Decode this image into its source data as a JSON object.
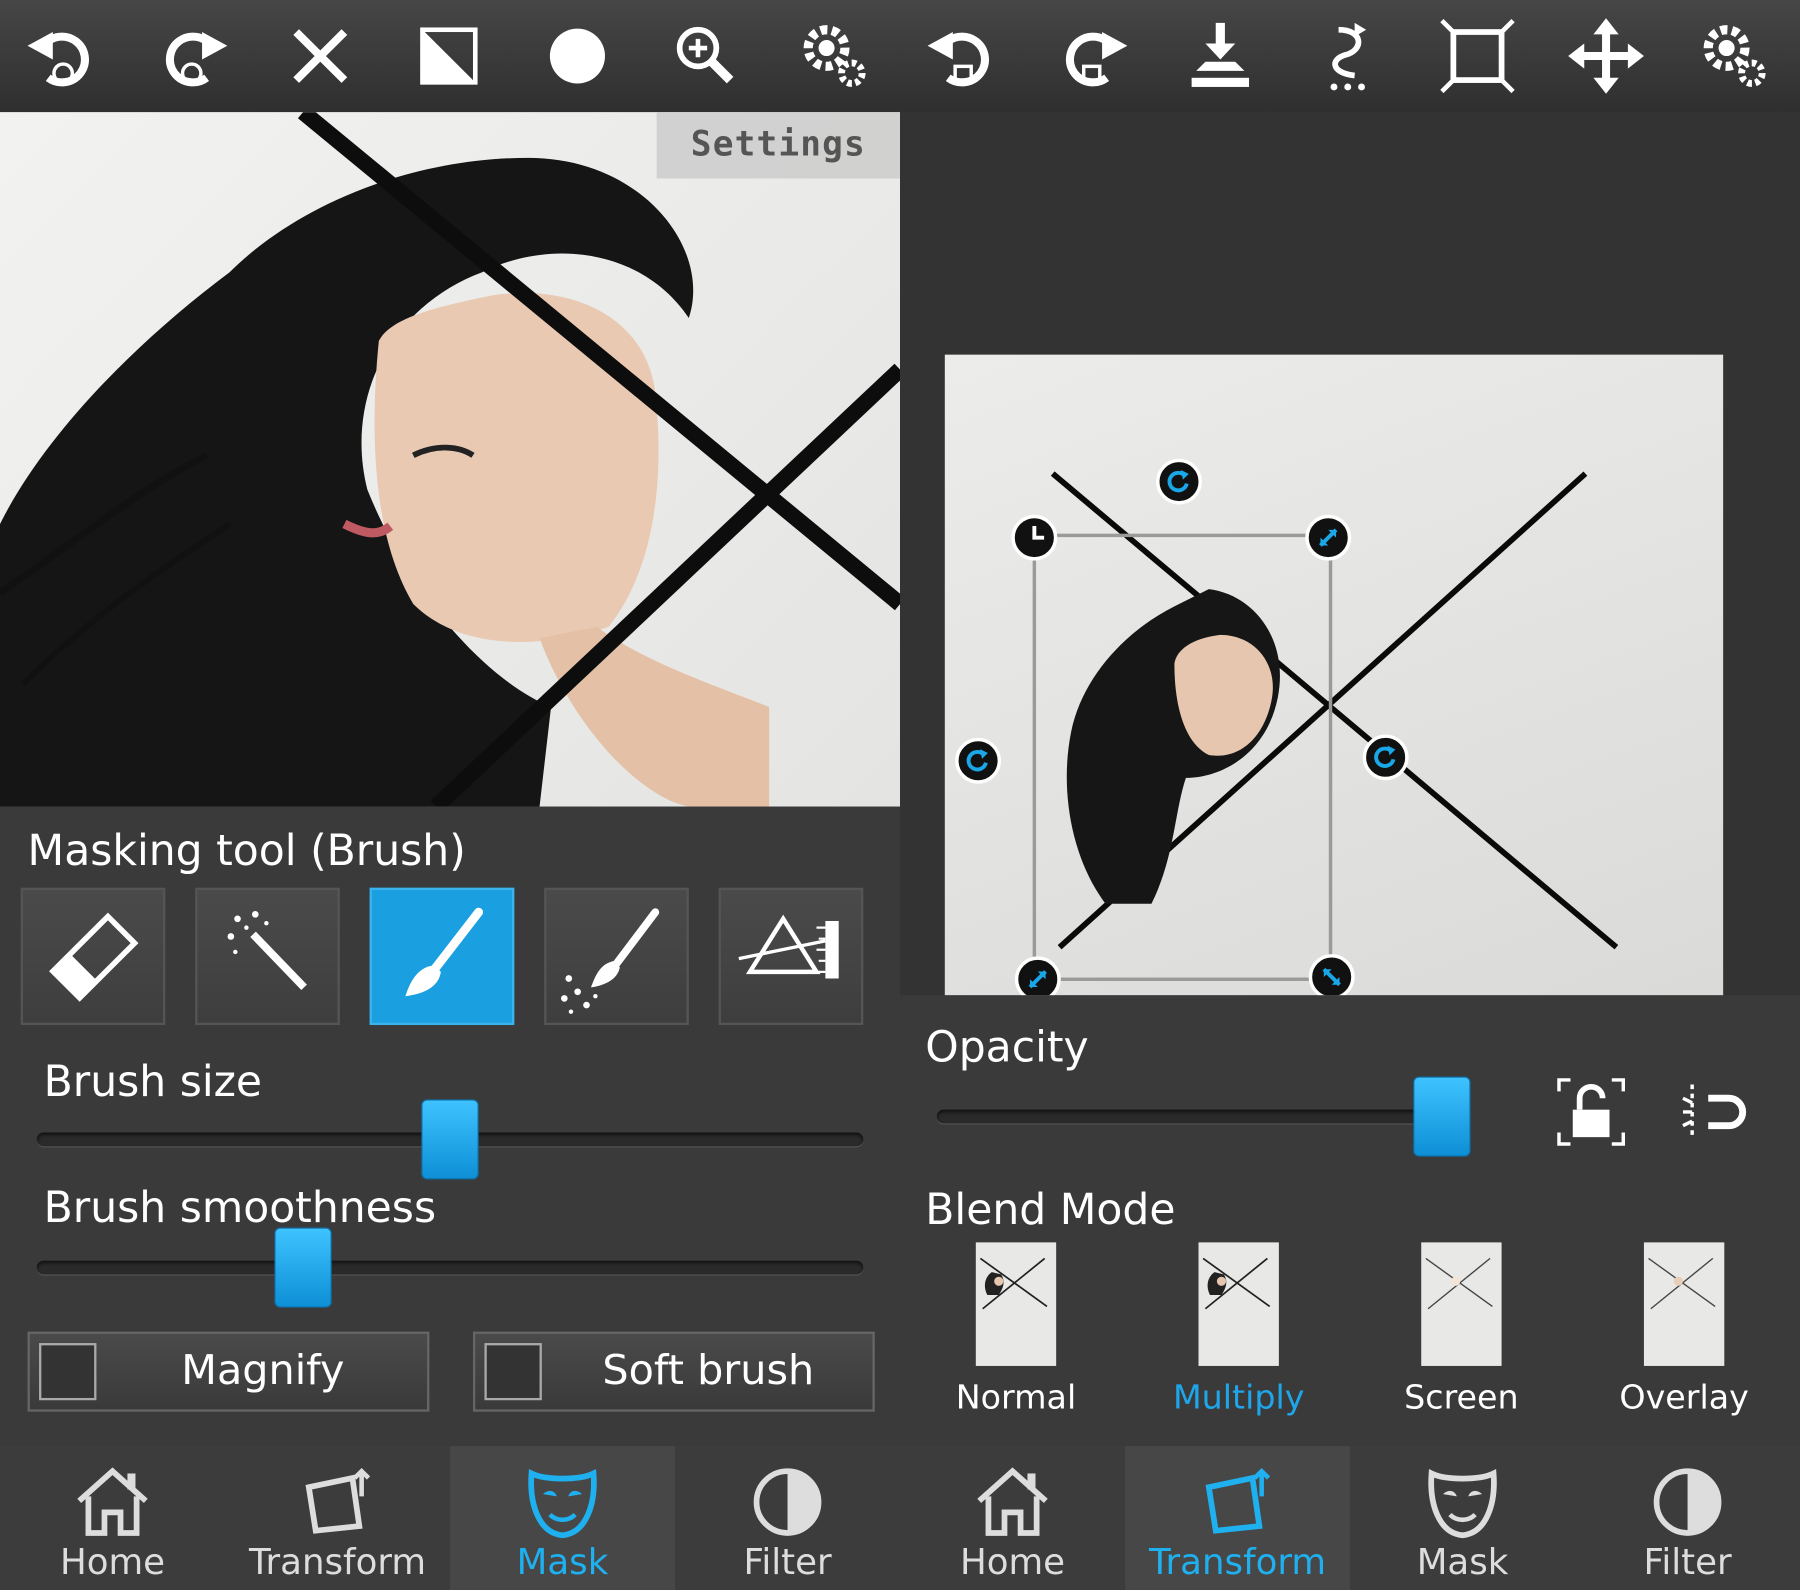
{
  "colors": {
    "accent": "#1a9fe0",
    "panel": "#3a3a3a",
    "toolbar": "#3a3a3a",
    "active_text": "#1fb0ef"
  },
  "left": {
    "toolbar": [
      "undo-icon",
      "redo-icon",
      "clear-icon",
      "invert-mask-icon",
      "brush-preview-icon",
      "zoom-icon",
      "settings-icon"
    ],
    "settings_label": "Settings",
    "tool_section_label": "Masking tool (Brush)",
    "tools": [
      "eraser-icon",
      "magic-wand-icon",
      "brush-icon",
      "spray-brush-icon",
      "gradient-ruler-icon"
    ],
    "active_tool": "brush",
    "brush_size_label": "Brush size",
    "brush_size": 0.5,
    "brush_smoothness_label": "Brush smoothness",
    "brush_smoothness": 0.31,
    "magnify_label": "Magnify",
    "magnify_checked": false,
    "soft_brush_label": "Soft brush",
    "soft_brush_checked": false,
    "nav": {
      "home": "Home",
      "transform": "Transform",
      "mask": "Mask",
      "filter": "Filter",
      "active": "mask"
    }
  },
  "right": {
    "toolbar": [
      "undo-icon",
      "redo-icon",
      "flatten-icon",
      "flip-icon",
      "fit-icon",
      "move-icon",
      "settings-icon"
    ],
    "opacity_label": "Opacity",
    "opacity": 1.0,
    "blend_label": "Blend Mode",
    "blend_modes": {
      "normal": "Normal",
      "multiply": "Multiply",
      "screen": "Screen",
      "overlay": "Overlay"
    },
    "active_blend": "multiply",
    "nav": {
      "home": "Home",
      "transform": "Transform",
      "mask": "Mask",
      "filter": "Filter",
      "active": "transform"
    }
  }
}
